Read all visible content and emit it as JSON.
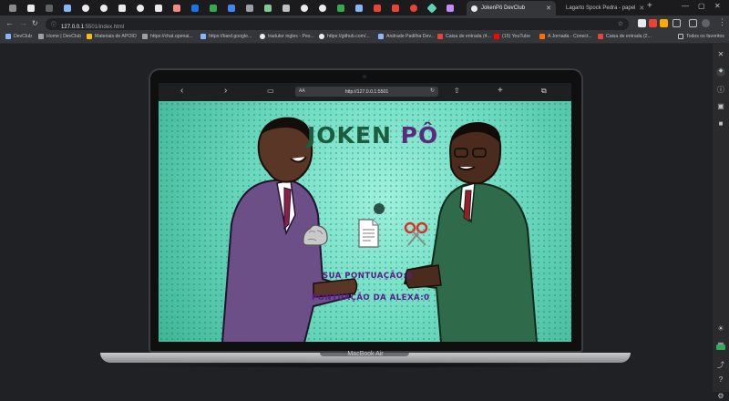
{
  "browser": {
    "active_tab_title": "JokenPô DevClub",
    "second_tab_title": "Lagarto Spock Pedra - papel",
    "url_host": "127.0.0.1",
    "url_path": ":5501/index.html",
    "new_tab": "+",
    "bookmarks": [
      "DevClub",
      "Home | DevClub",
      "Materiais de APOIO",
      "https://chat.openai...",
      "https://bard.google...",
      "tradutor ingles - Pes...",
      "https://github.com/...",
      "Andrade Padilha Dev...",
      "Caixa de entrada (4...",
      "(15) YouTube",
      "A Jornada - Conect...",
      "Caixa de entrada (2...",
      "Todos os favoritos"
    ],
    "accent_color": "#8ab4f8"
  },
  "device": {
    "brand_label": "MacBook Air",
    "safari_aa": "AA",
    "safari_url": "http://127.0.0.1:5501"
  },
  "game": {
    "title_part1": "JOKEN",
    "title_part2": "PÔ",
    "choices": [
      "rock-icon",
      "paper-icon",
      "scissors-icon"
    ],
    "player_score_label": "SUA PONTUAÇÃO:0",
    "alexa_score_label": "PONTUAÇÃO DA ALEXA:0",
    "title_colors": {
      "joken": "#1d5c3e",
      "po": "#5c2a7d"
    },
    "score_color": "#5b1b8c"
  }
}
